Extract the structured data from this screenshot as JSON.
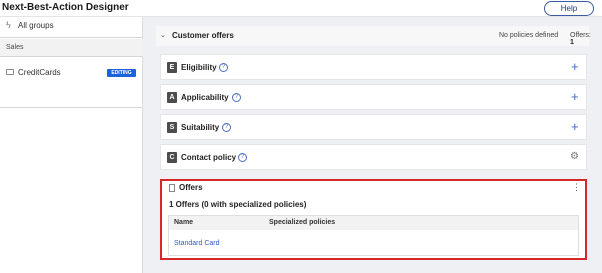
{
  "app": {
    "title": "Next-Best-Action Designer",
    "help_label": "Help"
  },
  "sidebar": {
    "all_groups_label": "All groups",
    "group_header": "Sales",
    "items": [
      {
        "label": "CreditCards",
        "badge": "EDITING"
      }
    ]
  },
  "main": {
    "section": {
      "title": "Customer offers",
      "policies_status": "No policies defined",
      "offers_count_label": "Offers:",
      "offers_count_value": "1"
    },
    "cards": [
      {
        "letter": "E",
        "title": "Eligibility",
        "action": "add"
      },
      {
        "letter": "A",
        "title": "Applicability",
        "action": "add"
      },
      {
        "letter": "S",
        "title": "Suitability",
        "action": "add"
      },
      {
        "letter": "C",
        "title": "Contact policy",
        "action": "settings"
      }
    ],
    "offers_panel": {
      "title": "Offers",
      "summary": "1 Offers (0 with specialized policies)",
      "table": {
        "columns": [
          "Name",
          "Specialized policies"
        ],
        "rows": [
          {
            "name": "Standard Card",
            "specialized_policies": ""
          }
        ]
      }
    }
  },
  "colors": {
    "accent": "#1a63d8",
    "link": "#2a5fc5",
    "highlight_border": "#d62828"
  }
}
